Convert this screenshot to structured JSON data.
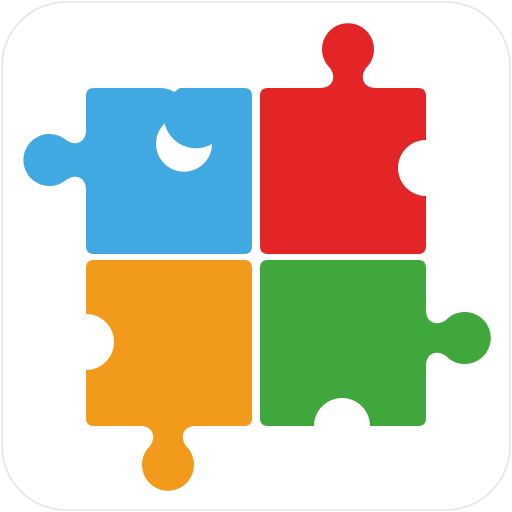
{
  "icon": {
    "name": "puzzle-app-icon",
    "pieces": [
      {
        "name": "puzzle-piece-blue",
        "color": "#41a9e1"
      },
      {
        "name": "puzzle-piece-red",
        "color": "#e42527"
      },
      {
        "name": "puzzle-piece-orange",
        "color": "#f29a1b"
      },
      {
        "name": "puzzle-piece-green",
        "color": "#3fa73b"
      }
    ],
    "tile_color": "#ffffff",
    "tile_edge_color": "#e4e4e4"
  }
}
